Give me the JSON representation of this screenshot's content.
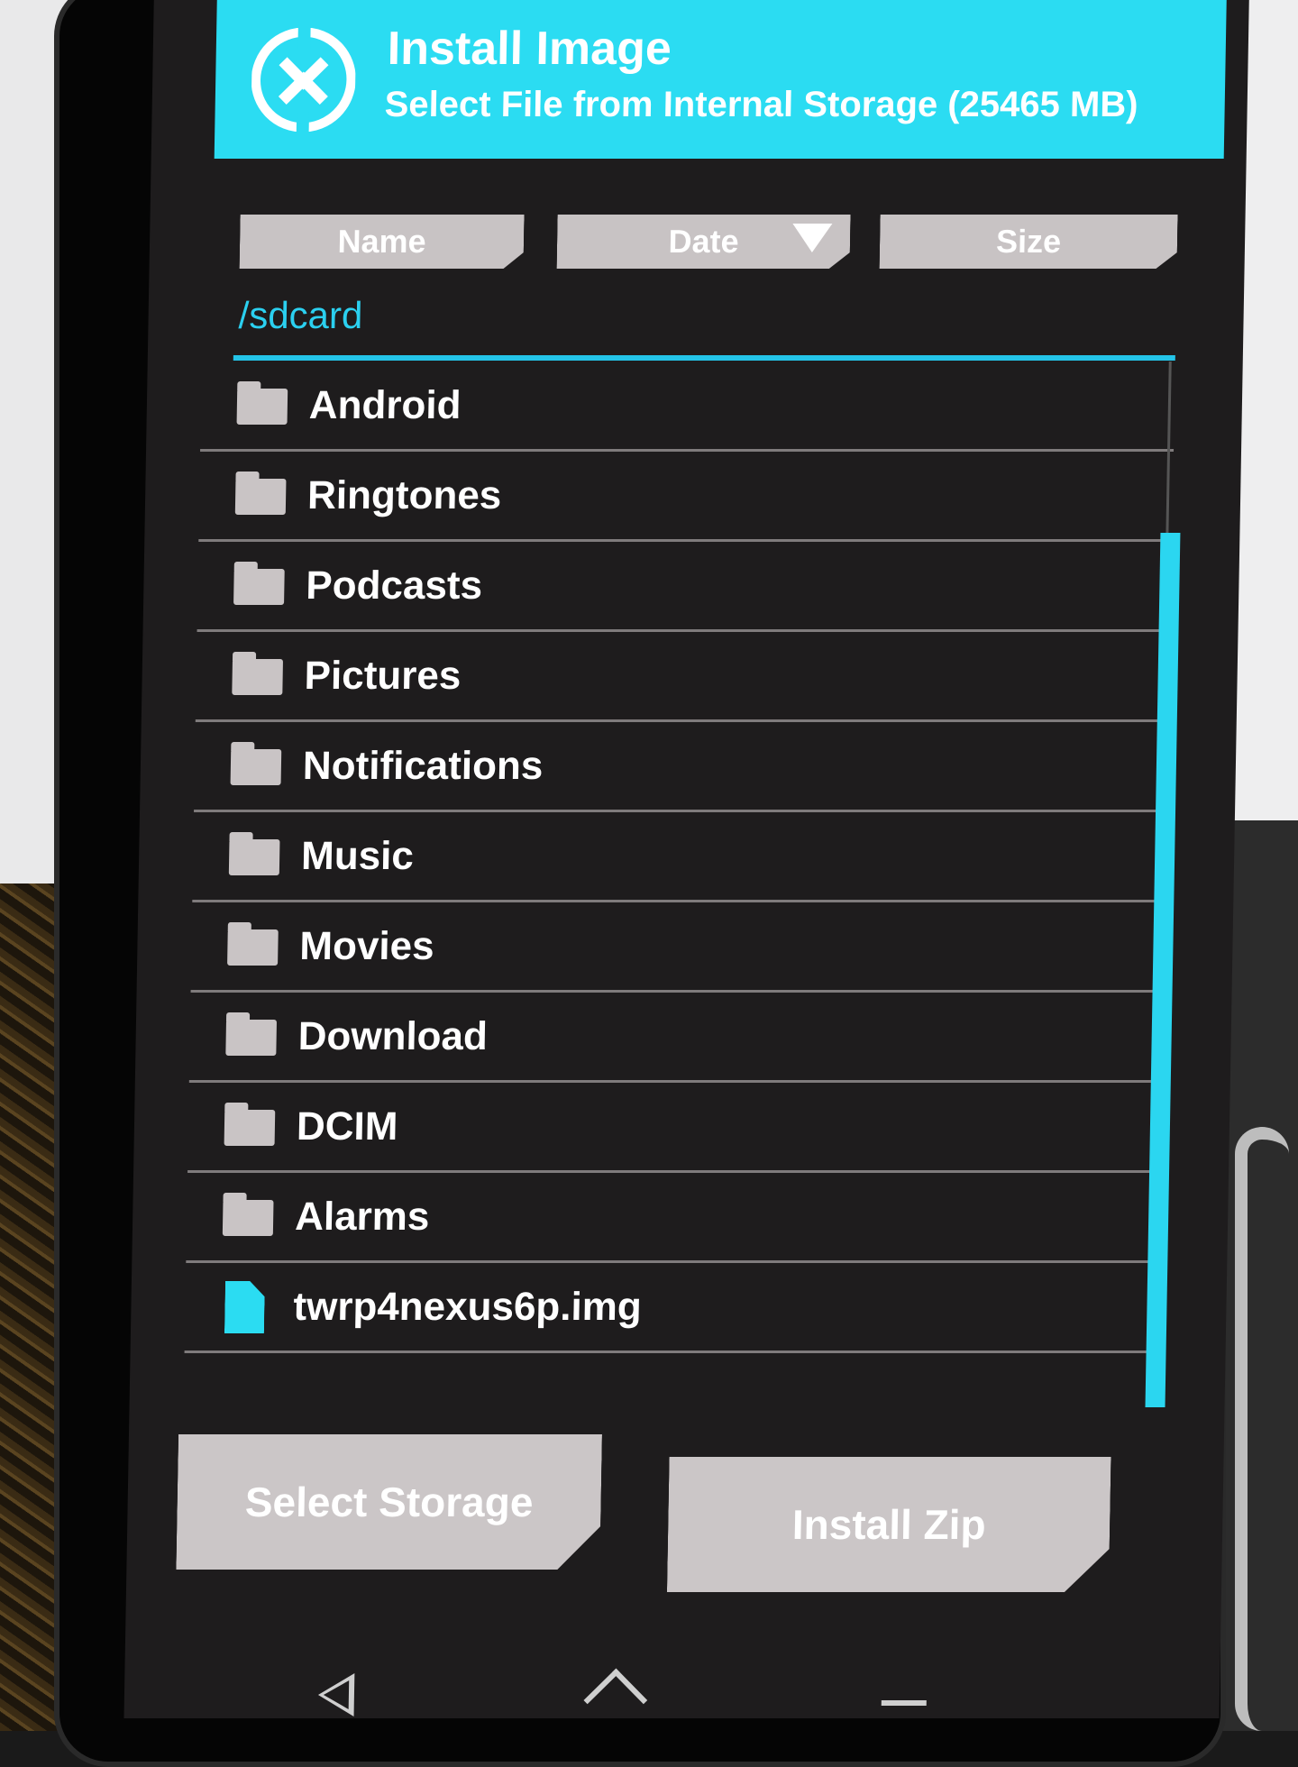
{
  "header": {
    "title": "Install Image",
    "subtitle": "Select File from Internal Storage (25465 MB)"
  },
  "sort": {
    "name_label": "Name",
    "date_label": "Date",
    "size_label": "Size"
  },
  "path": "/sdcard",
  "files": [
    {
      "label": "Android",
      "type": "folder"
    },
    {
      "label": "Ringtones",
      "type": "folder"
    },
    {
      "label": "Podcasts",
      "type": "folder"
    },
    {
      "label": "Pictures",
      "type": "folder"
    },
    {
      "label": "Notifications",
      "type": "folder"
    },
    {
      "label": "Music",
      "type": "folder"
    },
    {
      "label": "Movies",
      "type": "folder"
    },
    {
      "label": "Download",
      "type": "folder"
    },
    {
      "label": "DCIM",
      "type": "folder"
    },
    {
      "label": "Alarms",
      "type": "folder"
    },
    {
      "label": "twrp4nexus6p.img",
      "type": "file"
    }
  ],
  "buttons": {
    "select_storage": "Select Storage",
    "install_zip": "Install Zip"
  },
  "colors": {
    "accent": "#2bdcf2",
    "button": "#c8c3c4",
    "background": "#1e1c1d"
  }
}
